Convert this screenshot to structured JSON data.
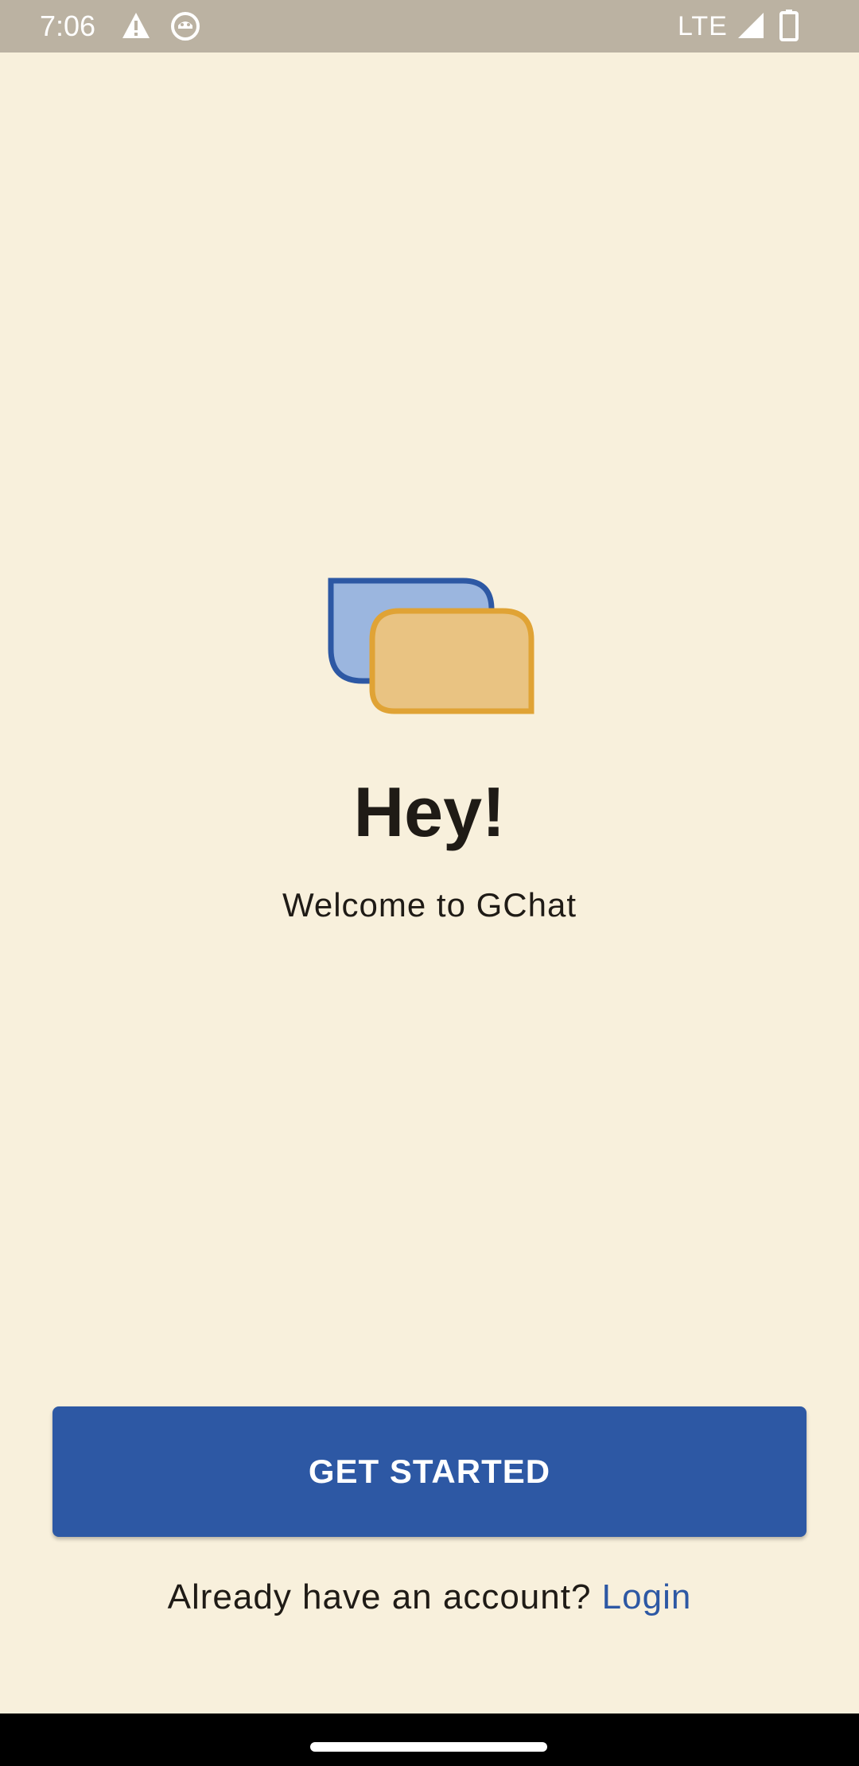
{
  "status_bar": {
    "time": "7:06",
    "network": "LTE",
    "icons": [
      "warning-icon",
      "app-notification-icon",
      "signal-icon",
      "battery-icon"
    ]
  },
  "logo": {
    "icon": "chat-bubbles-icon",
    "colors": {
      "back_bubble_fill": "#9bb6df",
      "back_bubble_stroke": "#2d58a4",
      "front_bubble_fill": "#e9c382",
      "front_bubble_stroke": "#e0a335"
    }
  },
  "welcome": {
    "title": "Hey!",
    "subtitle": "Welcome to GChat"
  },
  "actions": {
    "get_started_label": "GET STARTED",
    "login_prompt": "Already have an account?",
    "login_label": "Login"
  },
  "colors": {
    "background": "#f8f0dc",
    "primary": "#2d58a4",
    "status_bar": "#bbb2a2",
    "text": "#1f1b16"
  }
}
